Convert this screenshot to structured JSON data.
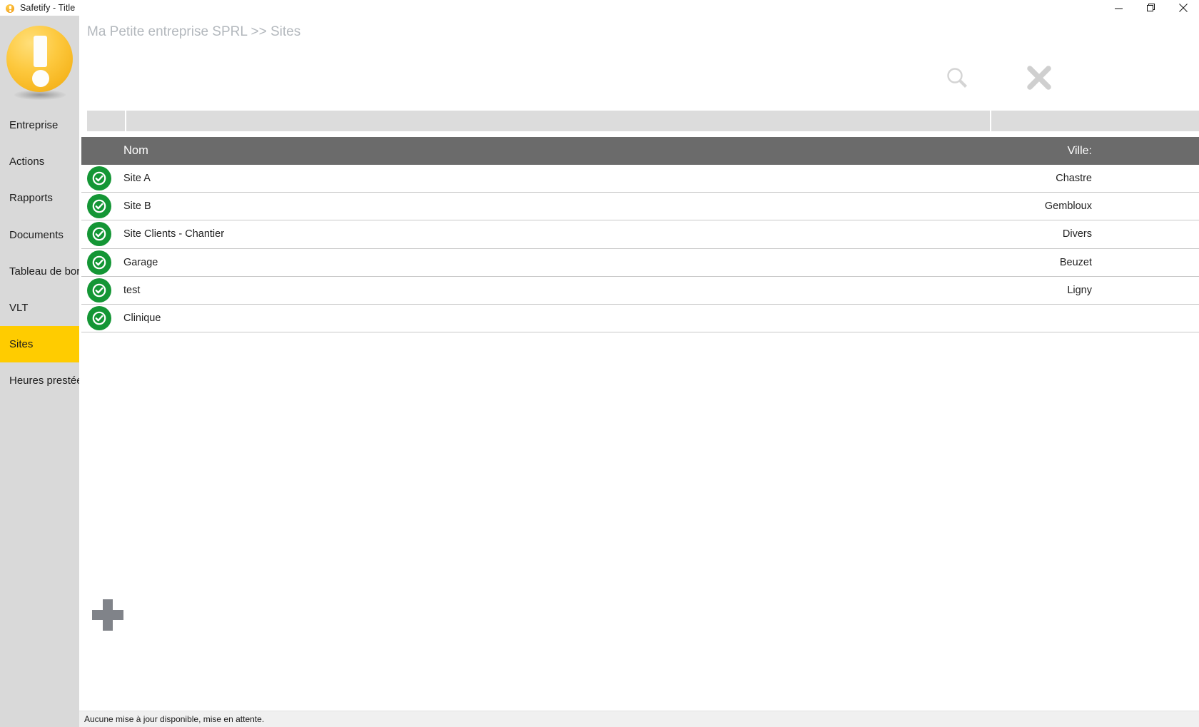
{
  "window": {
    "title": "Safetify - Title",
    "icon": "app-logo-icon",
    "controls": {
      "minimize": "minimize-icon",
      "maximize": "restore-icon",
      "close": "close-icon"
    }
  },
  "sidebar": {
    "logo": "exclamation-logo",
    "items": [
      {
        "label": "Entreprise",
        "active": false
      },
      {
        "label": "Actions",
        "active": false
      },
      {
        "label": "Rapports",
        "active": false
      },
      {
        "label": "Documents",
        "active": false
      },
      {
        "label": "Tableau de bord",
        "active": false
      },
      {
        "label": "VLT",
        "active": false
      },
      {
        "label": "Sites",
        "active": true
      },
      {
        "label": "Heures prestées",
        "active": false
      }
    ]
  },
  "header": {
    "breadcrumb": "Ma Petite entreprise SPRL >> Sites",
    "search_icon": "search-icon",
    "close_icon": "close-x-icon"
  },
  "table": {
    "columns": {
      "nom": "Nom",
      "ville": "Ville:"
    },
    "rows": [
      {
        "status": "ok",
        "nom": "Site A",
        "ville": "Chastre"
      },
      {
        "status": "ok",
        "nom": "Site B",
        "ville": "Gembloux"
      },
      {
        "status": "ok",
        "nom": "Site Clients - Chantier",
        "ville": "Divers"
      },
      {
        "status": "ok",
        "nom": "Garage",
        "ville": "Beuzet"
      },
      {
        "status": "ok",
        "nom": "test",
        "ville": "Ligny"
      },
      {
        "status": "ok",
        "nom": "Clinique",
        "ville": ""
      }
    ]
  },
  "actions": {
    "add": "add-plus-button"
  },
  "statusbar": {
    "message": "Aucune mise à jour disponible, mise en attente."
  },
  "colors": {
    "accent_yellow": "#ffcc00",
    "status_green": "#149635",
    "header_gray": "#6b6b6b",
    "sidebar_gray": "#d9d9d9"
  }
}
